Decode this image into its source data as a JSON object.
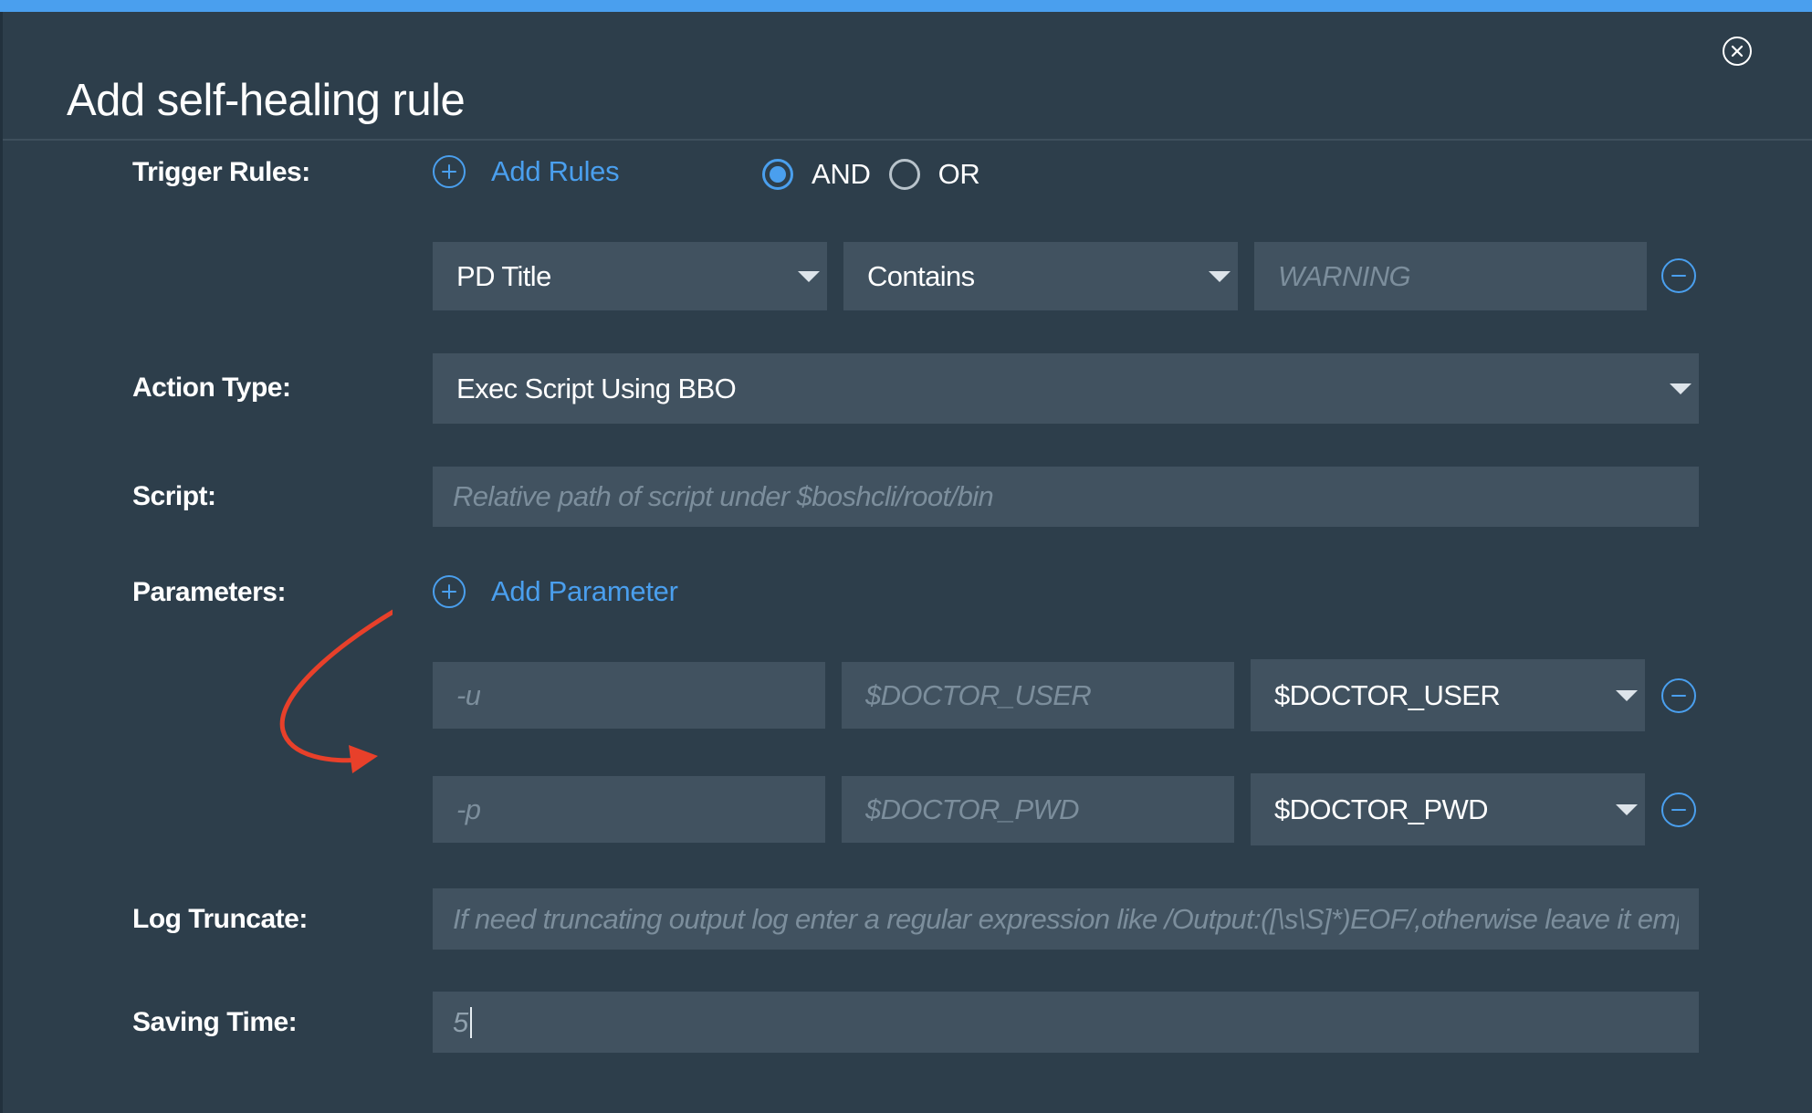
{
  "dialog": {
    "title": "Add self-healing rule",
    "close_icon": "close-circle-icon"
  },
  "trigger_rules": {
    "label": "Trigger Rules:",
    "add_label": "Add Rules",
    "logic_options": [
      {
        "label": "AND",
        "selected": true
      },
      {
        "label": "OR",
        "selected": false
      }
    ],
    "rows": [
      {
        "field": "PD Title",
        "operator": "Contains",
        "value_placeholder": "WARNING"
      }
    ]
  },
  "action_type": {
    "label": "Action Type:",
    "value": "Exec Script Using BBO"
  },
  "script": {
    "label": "Script:",
    "placeholder": "Relative path of script under $boshcli/root/bin"
  },
  "parameters": {
    "label": "Parameters:",
    "add_label": "Add Parameter",
    "rows": [
      {
        "flag_placeholder": "-u",
        "value_placeholder": "$DOCTOR_USER",
        "selected": "$DOCTOR_USER"
      },
      {
        "flag_placeholder": "-p",
        "value_placeholder": "$DOCTOR_PWD",
        "selected": "$DOCTOR_PWD"
      }
    ]
  },
  "log_truncate": {
    "label": "Log Truncate:",
    "placeholder": "If need truncating output log enter a regular expression like /Output:([\\s\\S]*)EOF/,otherwise leave it empty"
  },
  "saving_time": {
    "label": "Saving Time:",
    "value": "5"
  },
  "colors": {
    "background": "#2d3e4b",
    "field": "#415260",
    "accent": "#4a9fee",
    "annotation_arrow": "#e8402a"
  }
}
